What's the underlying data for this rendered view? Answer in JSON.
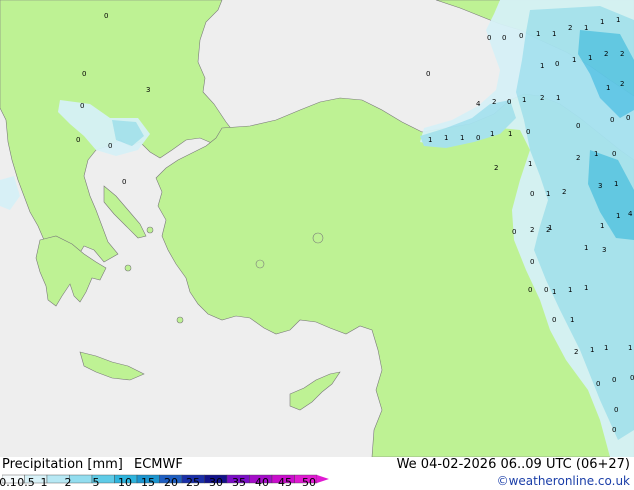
{
  "footer": {
    "title": "Precipitation [mm]",
    "model": "ECMWF",
    "datetime": "We 04-02-2026 06..09 UTC (06+27)",
    "credit": "©weatheronline.co.uk"
  },
  "legend": {
    "labels": [
      "0.1",
      "0.5",
      "1",
      "2",
      "5",
      "10",
      "15",
      "20",
      "25",
      "30",
      "35",
      "40",
      "45",
      "50"
    ],
    "colors": [
      "#f5fbfd",
      "#d8f2f8",
      "#b7e8f4",
      "#93ddef",
      "#5fcbe7",
      "#2fb4dd",
      "#1c95cf",
      "#1f5fc2",
      "#1a2fa8",
      "#12128a",
      "#7a0ec6",
      "#a40dc9",
      "#c90dcc",
      "#e01ad2"
    ]
  },
  "colors": {
    "land": "#bef294",
    "sea": "#eeeeee",
    "precip_light": "#d6f1f7",
    "precip_mid": "#a6e2f0",
    "precip_heavy": "#5ec6e6",
    "coast": "#7a7a7a"
  },
  "map": {
    "point_values": [
      "0",
      "0",
      "0",
      "0",
      "0",
      "0",
      "1",
      "1",
      "2",
      "1",
      "1",
      "1",
      "1",
      "0",
      "1",
      "1",
      "2",
      "2",
      "1",
      "2",
      "4",
      "2",
      "0",
      "1",
      "2",
      "1",
      "0",
      "0",
      "0",
      "3",
      "0",
      "1",
      "1",
      "1",
      "0",
      "1",
      "1",
      "0",
      "0",
      "0",
      "2",
      "1",
      "0",
      "2",
      "1",
      "3",
      "1",
      "4",
      "0",
      "0",
      "1",
      "2",
      "1",
      "1",
      "1",
      "0",
      "2",
      "2",
      "1",
      "0",
      "3",
      "0",
      "0",
      "1",
      "1",
      "1",
      "0",
      "1",
      "2",
      "1",
      "1",
      "1",
      "0",
      "0",
      "0",
      "0",
      "0"
    ]
  }
}
